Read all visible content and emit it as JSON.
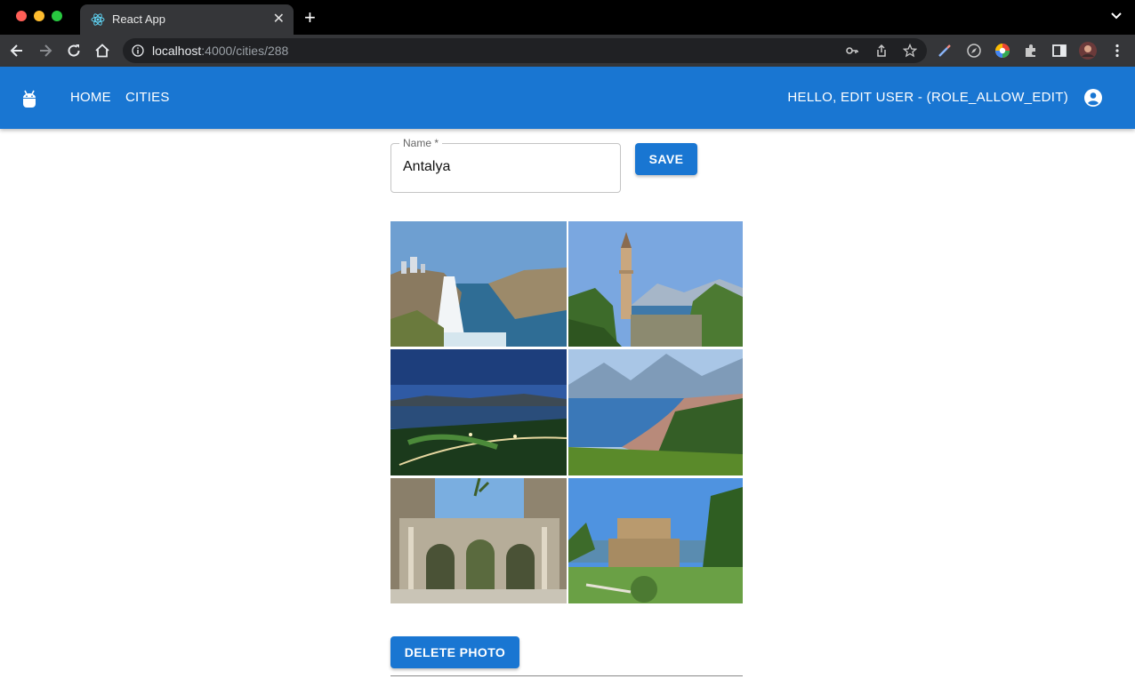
{
  "browser": {
    "tab_title": "React App",
    "url_host": "localhost",
    "url_path": ":4000/cities/288"
  },
  "appbar": {
    "nav": [
      "HOME",
      "CITIES"
    ],
    "greeting": "HELLO, EDIT USER - (ROLE_ALLOW_EDIT)"
  },
  "form": {
    "name_label": "Name *",
    "name_value": "Antalya",
    "save_label": "SAVE"
  },
  "photos": {
    "delete_label": "DELETE PHOTO"
  },
  "colors": {
    "primary": "#1976d2"
  }
}
